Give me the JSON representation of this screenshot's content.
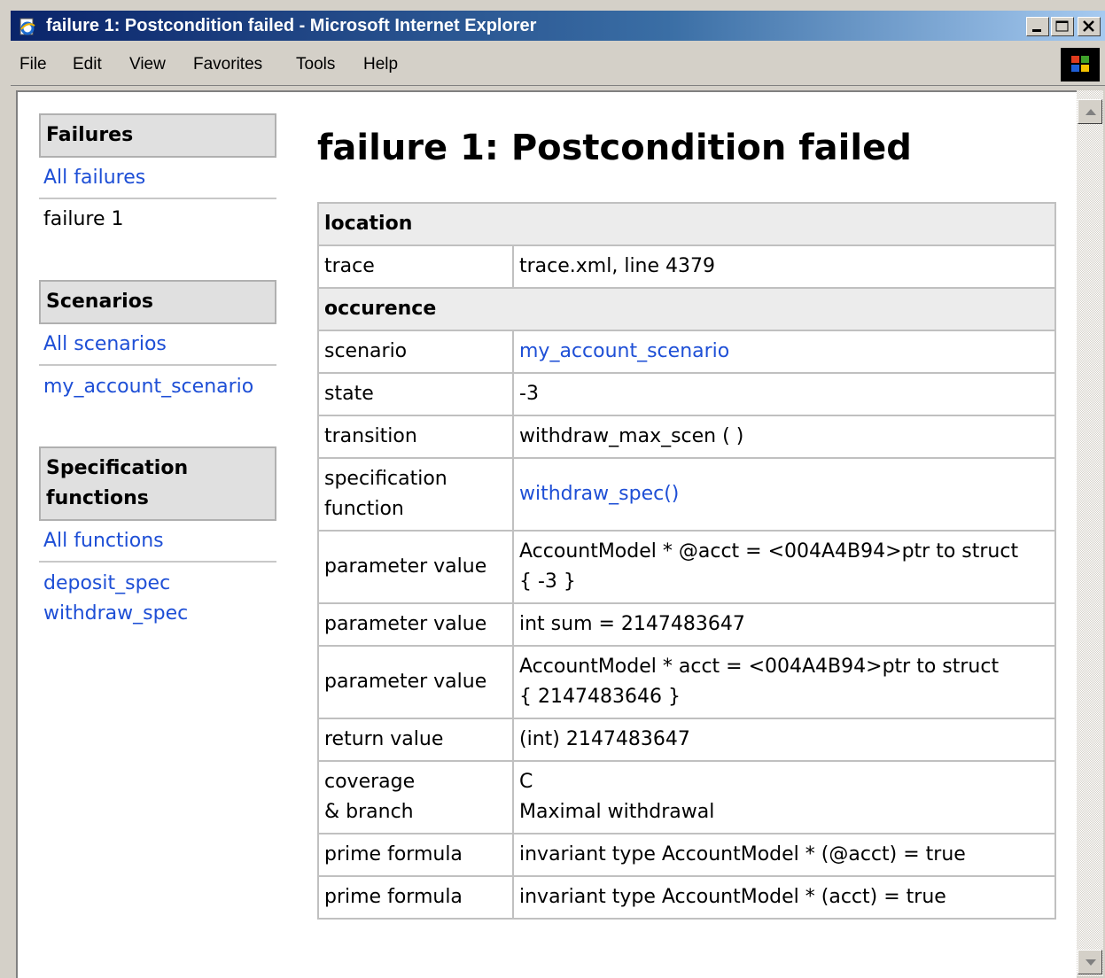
{
  "window": {
    "title": "failure 1: Postcondition failed - Microsoft Internet Explorer"
  },
  "menubar": {
    "items": [
      "File",
      "Edit",
      "View",
      "Favorites",
      "Tools",
      "Help"
    ]
  },
  "sidebar": {
    "failures": {
      "heading": "Failures",
      "all_link": "All failures",
      "items": [
        "failure 1"
      ]
    },
    "scenarios": {
      "heading": "Scenarios",
      "all_link": "All scenarios",
      "items": [
        "my_account_scenario"
      ]
    },
    "spec_functions": {
      "heading_line1": "Specification",
      "heading_line2": "functions",
      "all_link": "All functions",
      "items": [
        "deposit_spec",
        "withdraw_spec"
      ]
    }
  },
  "main": {
    "title": "failure 1: Postcondition failed",
    "sections": {
      "location": "location",
      "occurence": "occurence"
    },
    "rows": {
      "trace": {
        "key": "trace",
        "value": "trace.xml, line 4379"
      },
      "scenario": {
        "key": "scenario",
        "value": "my_account_scenario"
      },
      "state": {
        "key": "state",
        "value": "-3"
      },
      "transition": {
        "key": "transition",
        "value": "withdraw_max_scen ( )"
      },
      "spec_function": {
        "key_line1": "specification",
        "key_line2": "function",
        "value": "withdraw_spec()"
      },
      "param1": {
        "key": "parameter value",
        "value_line1": "AccountModel * @acct = <004A4B94>ptr to struct",
        "value_line2": "{ -3 }"
      },
      "param2": {
        "key": "parameter value",
        "value": "int sum = 2147483647"
      },
      "param3": {
        "key": "parameter value",
        "value_line1": "AccountModel * acct = <004A4B94>ptr to struct",
        "value_line2": "{ 2147483646 }"
      },
      "return": {
        "key": "return value",
        "value": "(int) 2147483647"
      },
      "coverage": {
        "key_line1": "coverage",
        "key_line2": "& branch",
        "value_line1": "C",
        "value_line2": "Maximal withdrawal"
      },
      "prime1": {
        "key": "prime formula",
        "value": "invariant type AccountModel * (@acct) = true"
      },
      "prime2": {
        "key": "prime formula",
        "value": "invariant type AccountModel * (acct) = true"
      }
    }
  },
  "colors": {
    "link": "#1e4fd6",
    "titlebar_start": "#0a246a",
    "titlebar_end": "#a6caf0",
    "chrome": "#d4d0c8"
  },
  "icons": [
    "ie-page-icon",
    "minimize-icon",
    "maximize-icon",
    "close-icon",
    "windows-logo-icon",
    "scroll-up-arrow-icon",
    "scroll-down-arrow-icon"
  ]
}
